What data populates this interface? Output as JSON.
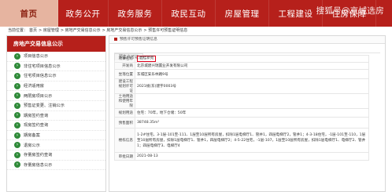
{
  "nav": {
    "items": [
      "首页",
      "政务公开",
      "政务服务",
      "政民互动",
      "房屋管理",
      "工程建设",
      "住房保障"
    ]
  },
  "watermark": "搜狐号@京城选房",
  "breadcrumb": {
    "label": "当前位置：",
    "items": [
      "首页",
      "房屋管理",
      "房地产交易信息公示",
      "房地产交易信息公示",
      "预售许可预售证明信息"
    ]
  },
  "sidebar": {
    "title": "房地产交易信息公示",
    "items": [
      "项目信息公示",
      "非住宅项目信息公示",
      "住宅项目信息公示",
      "经济适用房",
      "两限房项目公示",
      "预售证变更、注销公示",
      "期房签约查询",
      "现房签约查询",
      "期房备案",
      "退房公示",
      "存量房签约查询",
      "存量房信息公示"
    ]
  },
  "main": {
    "section_title": "预售许可预售证明信息",
    "tab": "预售许可证",
    "rows": [
      {
        "label": "项目名称",
        "value": "碧桂新苑",
        "highlight": true
      },
      {
        "label": "开发商",
        "value": "北京城建兴瑞置业开发有限公司"
      },
      {
        "label": "坐落位置",
        "value": "东城区安乐林路9号"
      },
      {
        "label": "建设工程规划许可证",
        "value": "2021规(东)建字0003号"
      },
      {
        "label": "土地用途和使用年限",
        "value": ""
      },
      {
        "label": "规划用途",
        "value": "住宅：70年，地下仓储：50年"
      },
      {
        "label": "预售面积",
        "value": "38748.35m²"
      },
      {
        "label": "楼栋信息",
        "value": "1-2#住宅，3-1层-101至-111、1层至10层所有房屋，扣除1层电梯厅1、管井1，四层电梯厅2，管井1；4-3-18住宅，-1层-101至-110，1层至10层所有房屋，扣除1层电梯厅1、管井1，四层电梯厅2；4-5-22住宅，-1层-107，1层至10层所有房屋，扣除1层电梯厅1、电梯厅2、管井1；四层电梯厅3、电梯厅4"
      },
      {
        "label": "审批日期",
        "value": "2021-08-13"
      }
    ]
  },
  "colors": {
    "nav_bg": "#b6201b",
    "nav_home_bg": "#e6b4a0",
    "sidebar_dot": "#2f8a39",
    "highlight_box": "#e0001a"
  }
}
